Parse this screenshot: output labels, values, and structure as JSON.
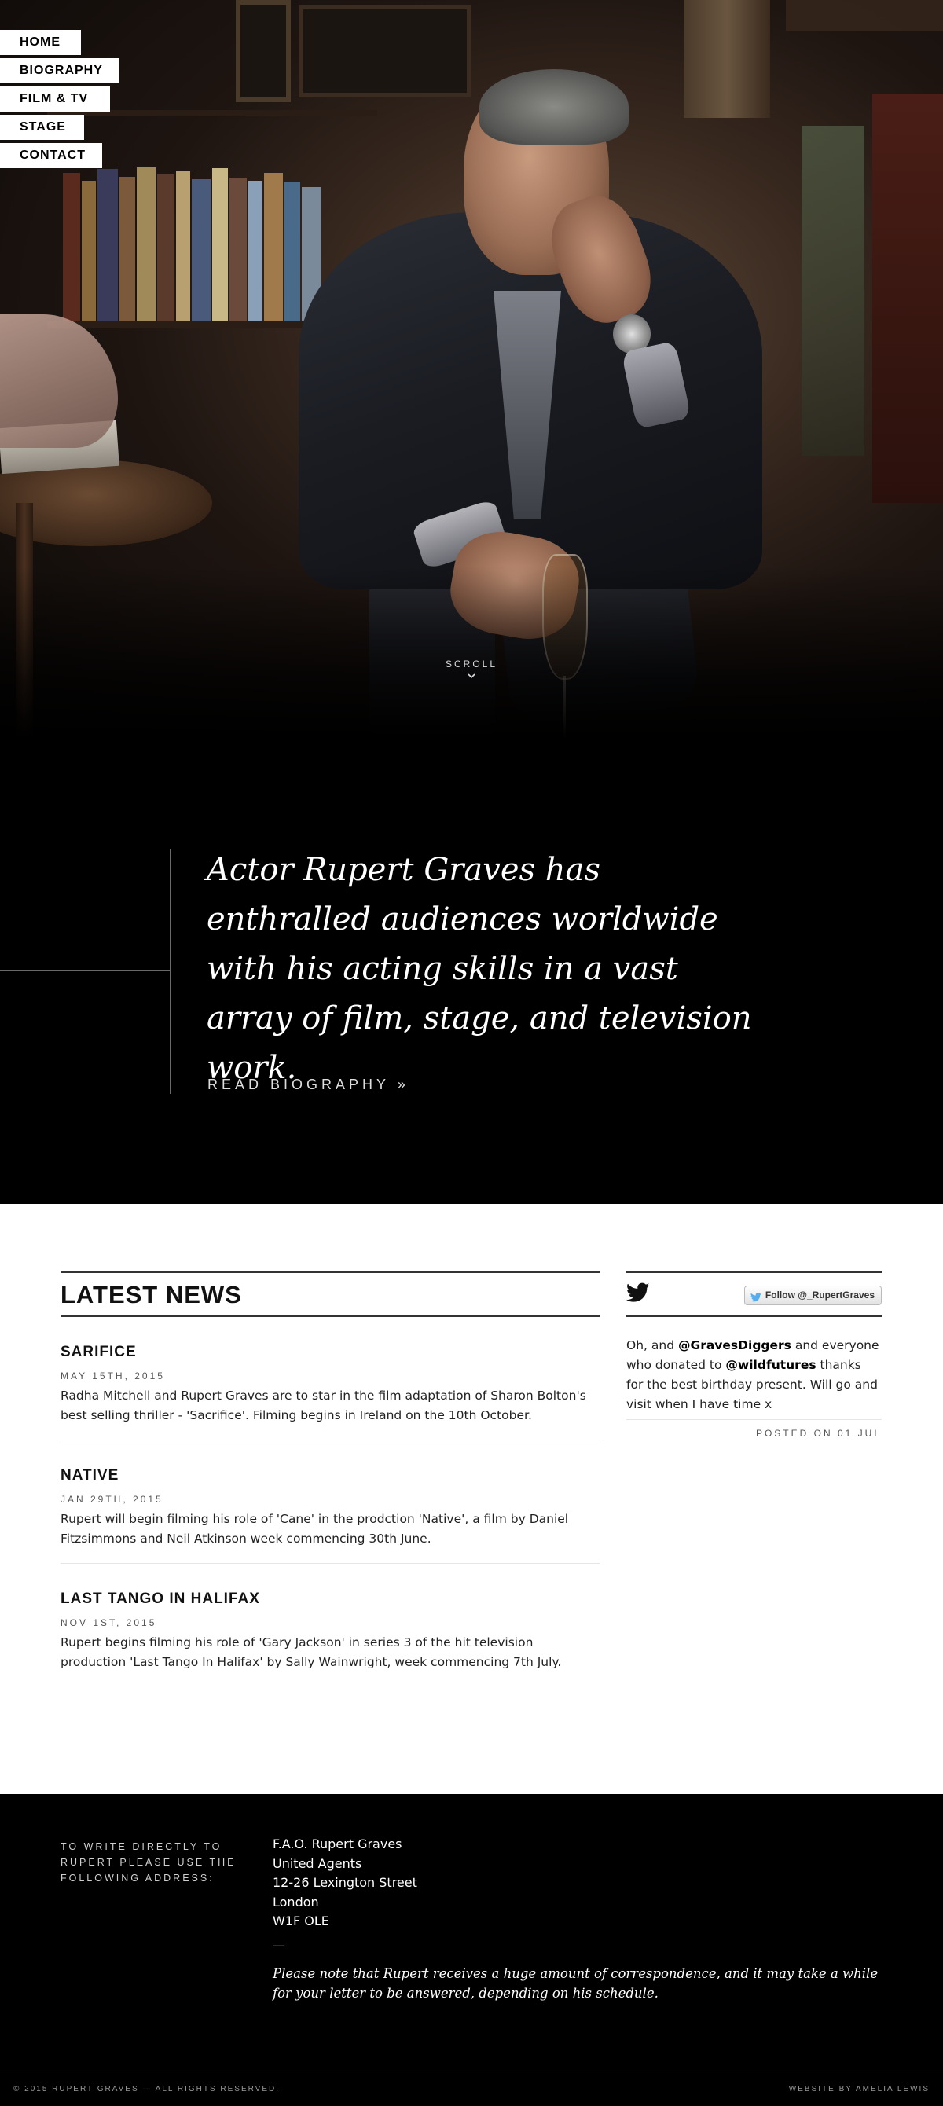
{
  "nav": {
    "items": [
      {
        "label": "HOME"
      },
      {
        "label": "BIOGRAPHY"
      },
      {
        "label": "FILM & TV"
      },
      {
        "label": "STAGE"
      },
      {
        "label": "CONTACT"
      }
    ]
  },
  "hero": {
    "scroll_label": "SCROLL",
    "scroll_icon": "chevron-down-icon"
  },
  "intro": {
    "quote": "Actor Rupert Graves has enthralled audiences worldwide with his acting skills in a vast array of film, stage, and television work.",
    "link_label": "READ BIOGRAPHY »"
  },
  "news": {
    "heading": "LATEST NEWS",
    "articles": [
      {
        "title": "SARIFICE",
        "date": "MAY 15TH, 2015",
        "body": "Radha Mitchell and Rupert Graves are to star in the film adaptation of Sharon Bolton's best selling thriller - 'Sacrifice'. Filming begins in Ireland on the 10th October."
      },
      {
        "title": "NATIVE",
        "date": "JAN 29TH, 2015",
        "body": "Rupert will begin filming his role of 'Cane' in the prodction 'Native', a film by Daniel Fitzsimmons and Neil Atkinson week commencing 30th June."
      },
      {
        "title": "LAST TANGO IN HALIFAX",
        "date": "NOV 1ST, 2015",
        "body": "Rupert begins filming his role of 'Gary Jackson' in series 3 of the hit television production 'Last Tango In Halifax' by Sally Wainwright, week commencing 7th July."
      }
    ]
  },
  "twitter": {
    "follow_label": "Follow @_RupertGraves",
    "tweet_prefix": "Oh, and ",
    "mention_1": "@GravesDiggers",
    "tweet_middle": " and everyone who donated to ",
    "mention_2": "@wildfutures",
    "tweet_suffix": " thanks for the best birthday present. Will go and visit when I have time x",
    "posted": "POSTED ON 01 JUL",
    "brand_color": "#55acee"
  },
  "footer": {
    "label": "TO WRITE DIRECTLY TO RUPERT PLEASE USE THE FOLLOWING ADDRESS:",
    "address": [
      "F.A.O. Rupert Graves",
      "United Agents",
      "12-26 Lexington Street",
      "London",
      "W1F OLE"
    ],
    "dash": "—",
    "note": "Please note that Rupert receives a huge amount of correspondence, and it may take a while for your letter to be answered, depending on his schedule.",
    "copyright": "© 2015 RUPERT GRAVES — ALL RIGHTS RESERVED.",
    "credit": "WEBSITE BY AMELIA LEWIS"
  }
}
